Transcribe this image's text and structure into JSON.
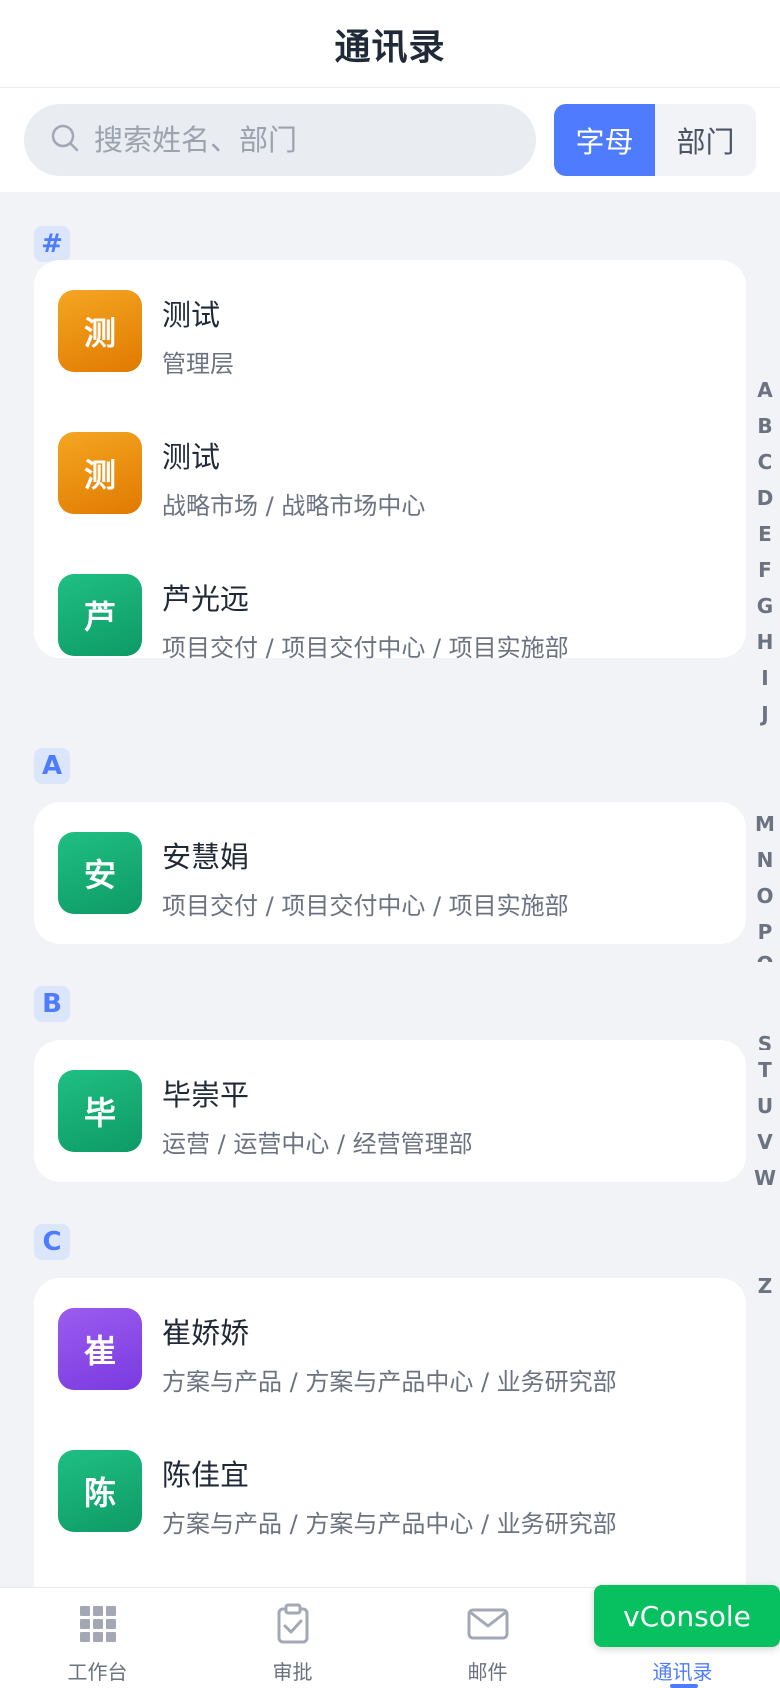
{
  "header": {
    "title": "通讯录"
  },
  "search": {
    "placeholder": "搜索姓名、部门",
    "value": ""
  },
  "sort_toggle": {
    "options": [
      "字母",
      "部门"
    ],
    "active": "字母"
  },
  "sections": [
    {
      "letter": "#",
      "contacts": [
        {
          "avatar_char": "测",
          "avatar_color": "#F29A1A",
          "name": "测试",
          "department": "管理层"
        },
        {
          "avatar_char": "测",
          "avatar_color": "#F29A1A",
          "name": "测试",
          "department": "战略市场 / 战略市场中心"
        },
        {
          "avatar_char": "芦",
          "avatar_color": "#17B077",
          "name": "芦光远",
          "department": "项目交付 / 项目交付中心 / 项目实施部"
        }
      ]
    },
    {
      "letter": "A",
      "contacts": [
        {
          "avatar_char": "安",
          "avatar_color": "#17B077",
          "name": "安慧娟",
          "department": "项目交付 / 项目交付中心 / 项目实施部"
        }
      ]
    },
    {
      "letter": "B",
      "contacts": [
        {
          "avatar_char": "毕",
          "avatar_color": "#17B077",
          "name": "毕崇平",
          "department": "运营 / 运营中心 / 经营管理部"
        }
      ]
    },
    {
      "letter": "C",
      "contacts": [
        {
          "avatar_char": "崔",
          "avatar_color": "#8B4CE8",
          "name": "崔娇娇",
          "department": "方案与产品 / 方案与产品中心 / 业务研究部"
        },
        {
          "avatar_char": "陈",
          "avatar_color": "#17B077",
          "name": "陈佳宜",
          "department": "方案与产品 / 方案与产品中心 / 业务研究部"
        }
      ]
    }
  ],
  "index_letters": [
    "A",
    "B",
    "C",
    "D",
    "E",
    "F",
    "G",
    "H",
    "I",
    "J",
    "M",
    "N",
    "O",
    "P",
    "Q",
    "S",
    "T",
    "U",
    "V",
    "W",
    "Z"
  ],
  "tabbar": {
    "tabs": [
      {
        "label": "工作台",
        "icon": "grid-icon"
      },
      {
        "label": "审批",
        "icon": "clipboard-check-icon"
      },
      {
        "label": "邮件",
        "icon": "mail-icon"
      },
      {
        "label": "通讯录",
        "icon": "contacts-icon"
      }
    ],
    "active": "通讯录"
  },
  "vconsole": {
    "label": "vConsole"
  },
  "colors": {
    "accent": "#4F7CFF",
    "vconsole": "#07C160"
  }
}
